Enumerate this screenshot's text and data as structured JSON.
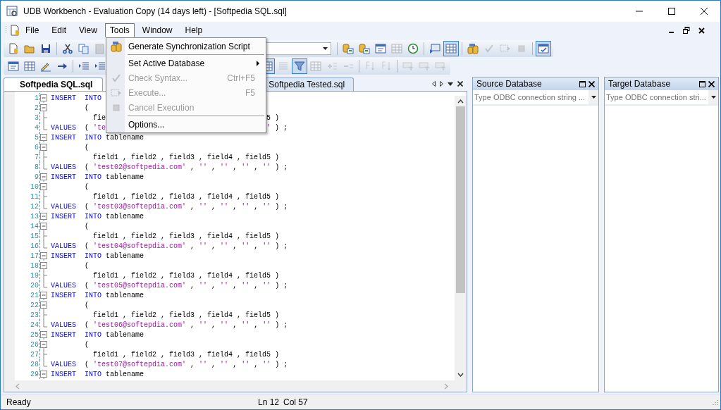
{
  "window": {
    "title": "UDB Workbench - Evaluation Copy (14 days left) - [Softpedia SQL.sql]"
  },
  "menu_bar": [
    {
      "label": "File",
      "selected": false
    },
    {
      "label": "Edit",
      "selected": false
    },
    {
      "label": "View",
      "selected": false
    },
    {
      "label": "Tools",
      "selected": true
    },
    {
      "label": "Window",
      "selected": false
    },
    {
      "label": "Help",
      "selected": false
    }
  ],
  "tools_menu": [
    {
      "kind": "item",
      "label": "Generate Synchronization Script",
      "disabled": false
    },
    {
      "kind": "separator"
    },
    {
      "kind": "item",
      "label": "Set Active Database",
      "disabled": false,
      "submenu": true
    },
    {
      "kind": "item",
      "label": "Check Syntax...",
      "shortcut": "Ctrl+F5",
      "disabled": true
    },
    {
      "kind": "item",
      "label": "Execute...",
      "shortcut": "F5",
      "disabled": true
    },
    {
      "kind": "item",
      "label": "Cancel Execution",
      "disabled": true
    },
    {
      "kind": "separator"
    },
    {
      "kind": "item",
      "label": "Options...",
      "disabled": false
    }
  ],
  "toolbar_1": {
    "left": [
      {
        "kind": "page",
        "pressed": false,
        "disabled": false
      },
      {
        "kind": "folder",
        "pressed": false,
        "disabled": false
      },
      {
        "kind": "floppy",
        "pressed": false,
        "disabled": false
      },
      {
        "kind": "separator"
      },
      {
        "kind": "scissors",
        "pressed": false,
        "disabled": false
      },
      {
        "kind": "copy",
        "pressed": false,
        "disabled": false
      },
      {
        "kind": "clipboard",
        "pressed": false,
        "disabled": true
      }
    ],
    "right": [
      {
        "kind": "combo"
      },
      {
        "kind": "separator"
      },
      {
        "kind": "database-arrow",
        "pressed": false,
        "disabled": false
      },
      {
        "kind": "database-arrow",
        "pressed": false,
        "disabled": false
      },
      {
        "kind": "window",
        "pressed": false,
        "disabled": false
      },
      {
        "kind": "grid",
        "pressed": false,
        "disabled": true
      },
      {
        "kind": "clock",
        "pressed": false,
        "disabled": false
      },
      {
        "kind": "separator"
      },
      {
        "kind": "monitor",
        "pressed": false,
        "disabled": false
      },
      {
        "kind": "monitor-grid",
        "pressed": true,
        "disabled": false
      },
      {
        "kind": "separator"
      },
      {
        "kind": "database-sync",
        "pressed": false,
        "disabled": false
      },
      {
        "kind": "sql-check",
        "pressed": false,
        "disabled": true
      },
      {
        "kind": "dashed-arrow",
        "pressed": false,
        "disabled": true
      },
      {
        "kind": "square",
        "pressed": false,
        "disabled": true
      },
      {
        "kind": "separator"
      },
      {
        "kind": "checklist",
        "pressed": true,
        "disabled": false
      }
    ]
  },
  "toolbar_2": {
    "left": [
      {
        "kind": "window",
        "pressed": false,
        "disabled": false
      },
      {
        "kind": "table-edit",
        "pressed": false,
        "disabled": false
      },
      {
        "kind": "pencil",
        "pressed": false,
        "disabled": false
      },
      {
        "kind": "arrow",
        "pressed": false,
        "disabled": false
      },
      {
        "kind": "separator"
      },
      {
        "kind": "indent",
        "pressed": false,
        "disabled": false
      },
      {
        "kind": "indent",
        "pressed": false,
        "disabled": false
      }
    ],
    "right": [
      {
        "kind": "table-link",
        "pressed": true,
        "disabled": false
      },
      {
        "kind": "list",
        "pressed": false,
        "disabled": true
      },
      {
        "kind": "funnel",
        "pressed": true,
        "disabled": false
      },
      {
        "kind": "columns",
        "pressed": false,
        "disabled": true
      },
      {
        "kind": "plus-list",
        "pressed": false,
        "disabled": true
      },
      {
        "kind": "minus-list",
        "pressed": false,
        "disabled": true
      },
      {
        "kind": "separator"
      },
      {
        "kind": "sort",
        "pressed": false,
        "disabled": true
      },
      {
        "kind": "sort",
        "pressed": false,
        "disabled": true
      },
      {
        "kind": "separator"
      },
      {
        "kind": "record",
        "pressed": false,
        "disabled": true
      },
      {
        "kind": "record",
        "pressed": false,
        "disabled": true
      },
      {
        "kind": "record",
        "pressed": false,
        "disabled": true
      }
    ]
  },
  "editor": {
    "tabs": [
      {
        "label": "Softpedia SQL.sql",
        "selected": true
      },
      {
        "label": "Softpedia Tested.sql",
        "selected": false
      }
    ],
    "lines": [
      {
        "number": "1",
        "kind": "collapse",
        "segments": [
          [
            {
              "kind": "keyword",
              "text": "INSERT  INTO"
            }
          ]
        ]
      },
      {
        "number": "2",
        "kind": "collapse",
        "segments": [
          [
            {
              "kind": "plain",
              "text": "        ("
            }
          ]
        ]
      },
      {
        "number": "3",
        "kind": "branch",
        "segments": [
          [
            {
              "kind": "plain",
              "text": "          fie"
            }
          ],
          [
            {
              "kind": "plain",
              "text": "                                      5 )"
            }
          ]
        ]
      },
      {
        "number": "4",
        "kind": "end",
        "segments": [
          [
            {
              "kind": "keyword",
              "text": "VALUES"
            },
            {
              "kind": "plain",
              "text": "  ( "
            },
            {
              "kind": "string",
              "text": "'te"
            }
          ],
          [
            {
              "kind": "string",
              "text": "                                      '"
            },
            {
              "kind": "plain",
              "text": " ) ;"
            }
          ]
        ]
      },
      {
        "number": "5",
        "kind": "collapse",
        "segments": [
          [
            {
              "kind": "keyword",
              "text": "INSERT  INTO"
            },
            {
              "kind": "plain",
              "text": " tablename"
            }
          ]
        ]
      },
      {
        "number": "6",
        "kind": "collapse",
        "segments": [
          [
            {
              "kind": "plain",
              "text": "        ("
            }
          ]
        ]
      },
      {
        "number": "7",
        "kind": "branch",
        "segments": [
          [
            {
              "kind": "plain",
              "text": "          field1 , field2 , field3 , field4 , field5 )"
            }
          ]
        ]
      },
      {
        "number": "8",
        "kind": "end",
        "segments": [
          [
            {
              "kind": "keyword",
              "text": "VALUES"
            },
            {
              "kind": "plain",
              "text": "  ( "
            },
            {
              "kind": "string",
              "text": "'test02@softpedia.com'"
            },
            {
              "kind": "plain",
              "text": " , "
            },
            {
              "kind": "string",
              "text": "''"
            },
            {
              "kind": "plain",
              "text": " , "
            },
            {
              "kind": "string",
              "text": "''"
            },
            {
              "kind": "plain",
              "text": " , "
            },
            {
              "kind": "string",
              "text": "''"
            },
            {
              "kind": "plain",
              "text": " , "
            },
            {
              "kind": "string",
              "text": "''"
            },
            {
              "kind": "plain",
              "text": " ) ;"
            }
          ]
        ]
      },
      {
        "number": "9",
        "kind": "collapse",
        "segments": [
          [
            {
              "kind": "keyword",
              "text": "INSERT  INTO"
            },
            {
              "kind": "plain",
              "text": " tablename"
            }
          ]
        ]
      },
      {
        "number": "10",
        "kind": "collapse",
        "segments": [
          [
            {
              "kind": "plain",
              "text": "        ("
            }
          ]
        ]
      },
      {
        "number": "11",
        "kind": "branch",
        "segments": [
          [
            {
              "kind": "plain",
              "text": "          field1 , field2 , field3 , field4 , field5 )"
            }
          ]
        ]
      },
      {
        "number": "12",
        "kind": "end",
        "segments": [
          [
            {
              "kind": "keyword",
              "text": "VALUES"
            },
            {
              "kind": "plain",
              "text": "  ( "
            },
            {
              "kind": "string",
              "text": "'test03@softepdia.com'"
            },
            {
              "kind": "plain",
              "text": " , "
            },
            {
              "kind": "string",
              "text": "''"
            },
            {
              "kind": "plain",
              "text": " , "
            },
            {
              "kind": "string",
              "text": "''"
            },
            {
              "kind": "plain",
              "text": " , "
            },
            {
              "kind": "string",
              "text": "''"
            },
            {
              "kind": "plain",
              "text": " , "
            },
            {
              "kind": "string",
              "text": "''"
            },
            {
              "kind": "plain",
              "text": " ) ;"
            }
          ]
        ]
      },
      {
        "number": "13",
        "kind": "collapse",
        "segments": [
          [
            {
              "kind": "keyword",
              "text": "INSERT  INTO"
            },
            {
              "kind": "plain",
              "text": " tablename"
            }
          ]
        ]
      },
      {
        "number": "14",
        "kind": "collapse",
        "segments": [
          [
            {
              "kind": "plain",
              "text": "        ("
            }
          ]
        ]
      },
      {
        "number": "15",
        "kind": "branch",
        "segments": [
          [
            {
              "kind": "plain",
              "text": "          field1 , field2 , field3 , field4 , field5 )"
            }
          ]
        ]
      },
      {
        "number": "16",
        "kind": "end",
        "segments": [
          [
            {
              "kind": "keyword",
              "text": "VALUES"
            },
            {
              "kind": "plain",
              "text": "  ( "
            },
            {
              "kind": "string",
              "text": "'test04@softepdia.com'"
            },
            {
              "kind": "plain",
              "text": " , "
            },
            {
              "kind": "string",
              "text": "''"
            },
            {
              "kind": "plain",
              "text": " , "
            },
            {
              "kind": "string",
              "text": "''"
            },
            {
              "kind": "plain",
              "text": " , "
            },
            {
              "kind": "string",
              "text": "''"
            },
            {
              "kind": "plain",
              "text": " , "
            },
            {
              "kind": "string",
              "text": "''"
            },
            {
              "kind": "plain",
              "text": " ) ;"
            }
          ]
        ]
      },
      {
        "number": "17",
        "kind": "collapse",
        "segments": [
          [
            {
              "kind": "keyword",
              "text": "INSERT  INTO"
            },
            {
              "kind": "plain",
              "text": " tablename"
            }
          ]
        ]
      },
      {
        "number": "18",
        "kind": "collapse",
        "segments": [
          [
            {
              "kind": "plain",
              "text": "        ("
            }
          ]
        ]
      },
      {
        "number": "19",
        "kind": "branch",
        "segments": [
          [
            {
              "kind": "plain",
              "text": "          field1 , field2 , field3 , field4 , field5 )"
            }
          ]
        ]
      },
      {
        "number": "20",
        "kind": "end",
        "segments": [
          [
            {
              "kind": "keyword",
              "text": "VALUES"
            },
            {
              "kind": "plain",
              "text": "  ( "
            },
            {
              "kind": "string",
              "text": "'test05@softepdia.com'"
            },
            {
              "kind": "plain",
              "text": " , "
            },
            {
              "kind": "string",
              "text": "''"
            },
            {
              "kind": "plain",
              "text": " , "
            },
            {
              "kind": "string",
              "text": "''"
            },
            {
              "kind": "plain",
              "text": " , "
            },
            {
              "kind": "string",
              "text": "''"
            },
            {
              "kind": "plain",
              "text": " , "
            },
            {
              "kind": "string",
              "text": "''"
            },
            {
              "kind": "plain",
              "text": " ) ;"
            }
          ]
        ]
      },
      {
        "number": "21",
        "kind": "collapse",
        "segments": [
          [
            {
              "kind": "keyword",
              "text": "INSERT  INTO"
            },
            {
              "kind": "plain",
              "text": " tablename"
            }
          ]
        ]
      },
      {
        "number": "22",
        "kind": "collapse",
        "segments": [
          [
            {
              "kind": "plain",
              "text": "        ("
            }
          ]
        ]
      },
      {
        "number": "23",
        "kind": "branch",
        "segments": [
          [
            {
              "kind": "plain",
              "text": "          field1 , field2 , field3 , field4 , field5 )"
            }
          ]
        ]
      },
      {
        "number": "24",
        "kind": "end",
        "segments": [
          [
            {
              "kind": "keyword",
              "text": "VALUES"
            },
            {
              "kind": "plain",
              "text": "  ( "
            },
            {
              "kind": "string",
              "text": "'test06@softepdia.com'"
            },
            {
              "kind": "plain",
              "text": " , "
            },
            {
              "kind": "string",
              "text": "''"
            },
            {
              "kind": "plain",
              "text": " , "
            },
            {
              "kind": "string",
              "text": "''"
            },
            {
              "kind": "plain",
              "text": " , "
            },
            {
              "kind": "string",
              "text": "''"
            },
            {
              "kind": "plain",
              "text": " , "
            },
            {
              "kind": "string",
              "text": "''"
            },
            {
              "kind": "plain",
              "text": " ) ;"
            }
          ]
        ]
      },
      {
        "number": "25",
        "kind": "collapse",
        "segments": [
          [
            {
              "kind": "keyword",
              "text": "INSERT  INTO"
            },
            {
              "kind": "plain",
              "text": " tablename"
            }
          ]
        ]
      },
      {
        "number": "26",
        "kind": "collapse",
        "segments": [
          [
            {
              "kind": "plain",
              "text": "        ("
            }
          ]
        ]
      },
      {
        "number": "27",
        "kind": "branch",
        "segments": [
          [
            {
              "kind": "plain",
              "text": "          field1 , field2 , field3 , field4 , field5 )"
            }
          ]
        ]
      },
      {
        "number": "28",
        "kind": "end",
        "segments": [
          [
            {
              "kind": "keyword",
              "text": "VALUES"
            },
            {
              "kind": "plain",
              "text": "  ( "
            },
            {
              "kind": "string",
              "text": "'test07@softepdia.com'"
            },
            {
              "kind": "plain",
              "text": " , "
            },
            {
              "kind": "string",
              "text": "''"
            },
            {
              "kind": "plain",
              "text": " , "
            },
            {
              "kind": "string",
              "text": "''"
            },
            {
              "kind": "plain",
              "text": " , "
            },
            {
              "kind": "string",
              "text": "''"
            },
            {
              "kind": "plain",
              "text": " , "
            },
            {
              "kind": "string",
              "text": "''"
            },
            {
              "kind": "plain",
              "text": " ) ;"
            }
          ]
        ]
      },
      {
        "number": "29",
        "kind": "collapse",
        "segments": [
          [
            {
              "kind": "keyword",
              "text": "INSERT  INTO"
            },
            {
              "kind": "plain",
              "text": " tablename"
            }
          ]
        ]
      }
    ]
  },
  "panels": [
    {
      "title": "Source Database",
      "placeholder": "Type ODBC connection string ..."
    },
    {
      "title": "Target Database",
      "placeholder": "Type ODBC connection stri..."
    }
  ],
  "status_bar": {
    "message": "Ready",
    "line": "Ln 12",
    "column": "Col 57"
  }
}
